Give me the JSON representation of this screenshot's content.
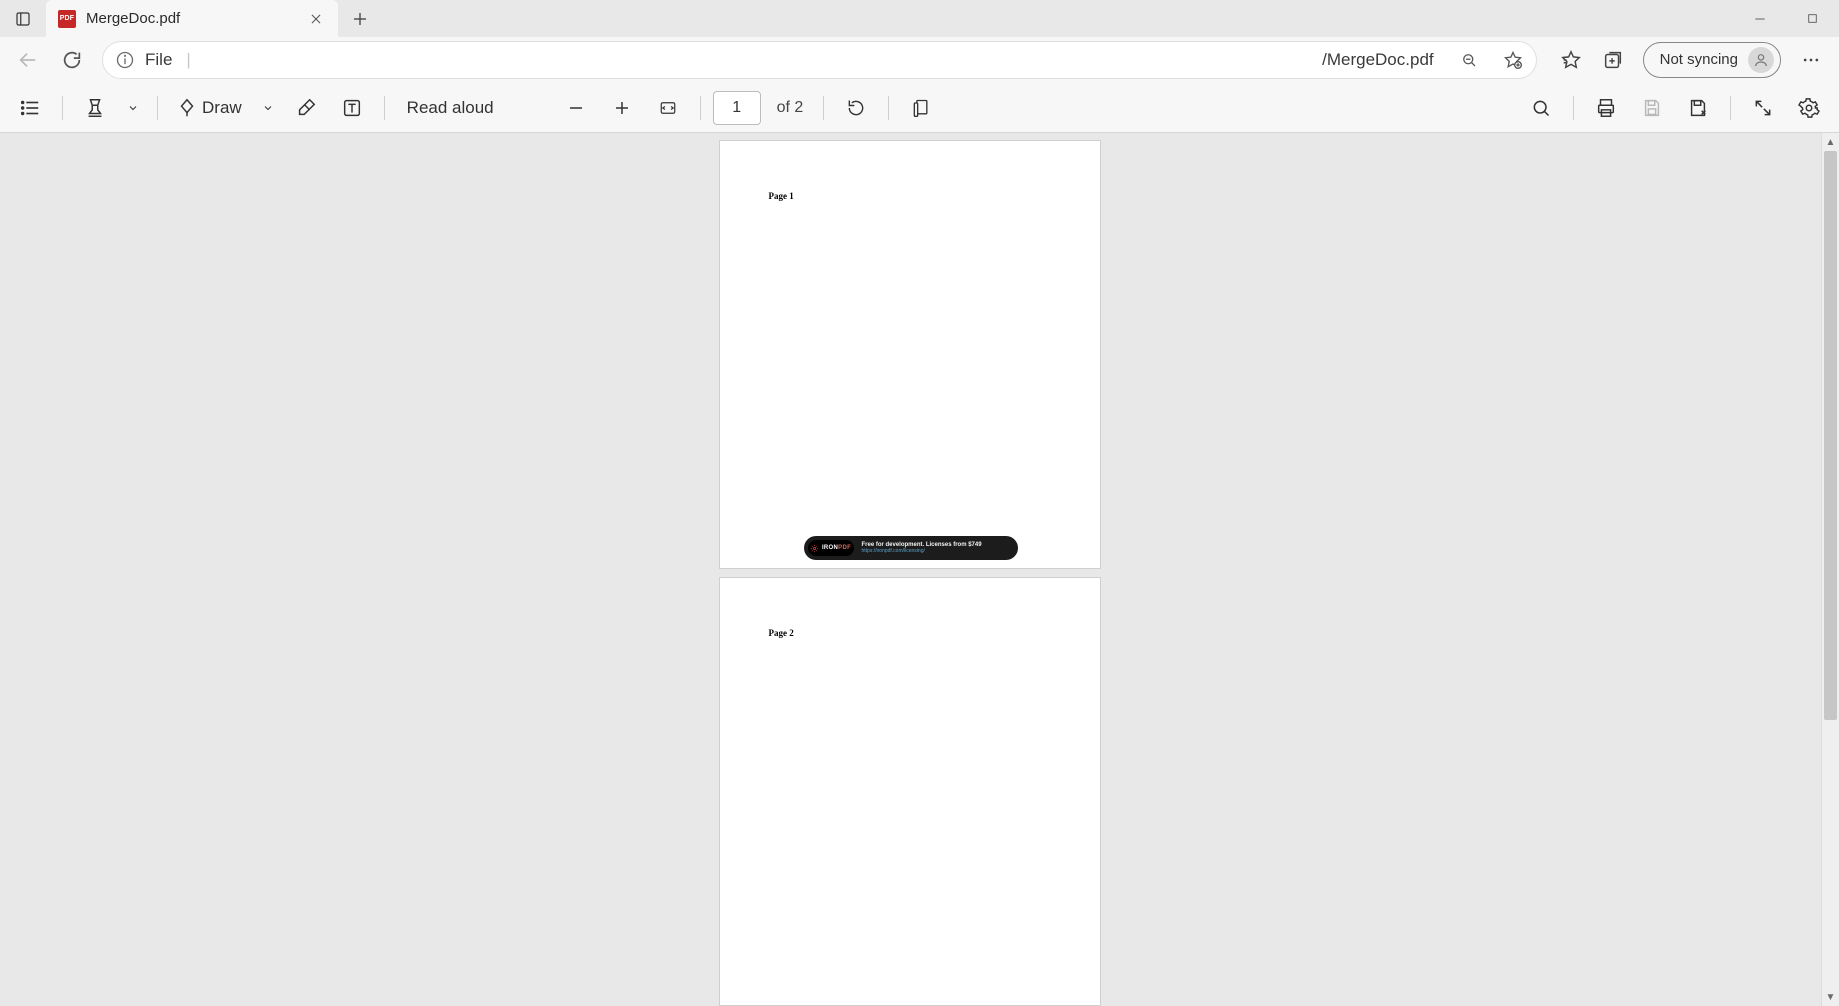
{
  "window": {
    "tab_title": "MergeDoc.pdf"
  },
  "address_bar": {
    "scheme_label": "File",
    "path_suffix": "/MergeDoc.pdf"
  },
  "browser_toolbar": {
    "sync_label": "Not syncing"
  },
  "pdf_toolbar": {
    "draw_label": "Draw",
    "read_aloud_label": "Read aloud",
    "page_input_value": "1",
    "page_of_label": "of 2"
  },
  "document": {
    "pages": [
      {
        "heading": "Page 1"
      },
      {
        "heading": "Page 2"
      }
    ],
    "watermark": {
      "brand_prefix": "IRON",
      "brand_suffix": "PDF",
      "line1": "Free for development. Licenses from $749",
      "line2": "https://ironpdf.com/licensing/"
    }
  }
}
